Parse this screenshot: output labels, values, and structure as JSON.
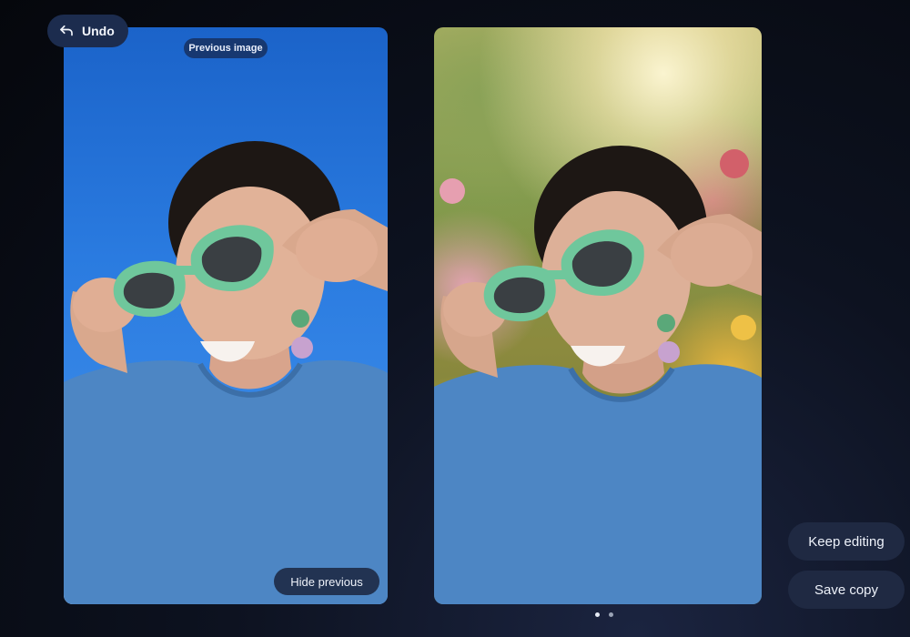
{
  "toolbar": {
    "undo_label": "Undo",
    "undo_icon": "undo-arrow-icon"
  },
  "compare": {
    "previous_label": "Previous image",
    "hide_previous_label": "Hide previous"
  },
  "actions": {
    "keep_editing_label": "Keep editing",
    "save_copy_label": "Save copy"
  },
  "pager": {
    "count": 2,
    "active_index": 0
  },
  "colors": {
    "button_bg": "#1f2942",
    "undo_bg": "#1c2c4e",
    "sky_blue": "#2a7be0",
    "glasses_green": "#6fc79c",
    "shirt_blue": "#4d86c4"
  }
}
